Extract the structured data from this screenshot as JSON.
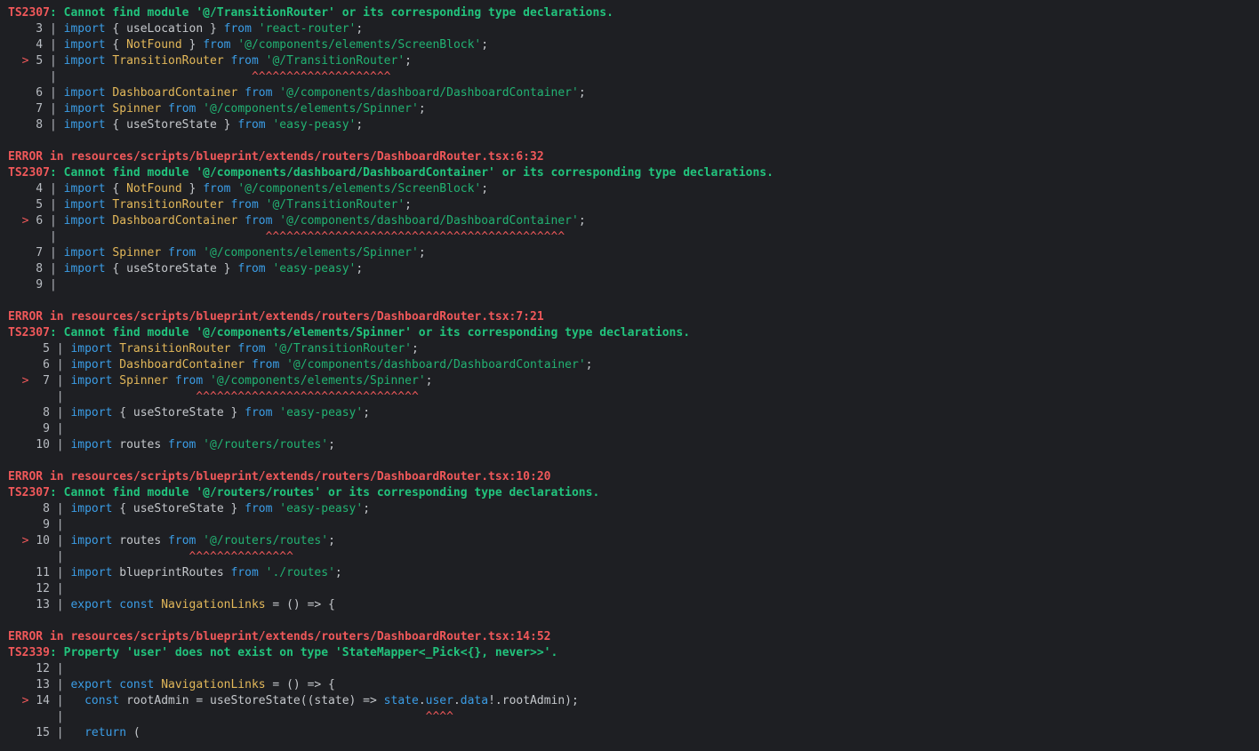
{
  "colors": {
    "background": "#1e1f23",
    "error": "#f0585a",
    "message": "#22c47d",
    "keyword": "#3b9de6",
    "identifier": "#e3b85a",
    "string": "#22b373",
    "plain": "#c5c8cc"
  },
  "lines": [
    [
      [
        "red",
        "TS2307"
      ],
      [
        "grn",
        ": Cannot find module '@/TransitionRouter' or its corresponding type declarations."
      ]
    ],
    [
      [
        "ln",
        "    3 | "
      ],
      [
        "kw",
        "import"
      ],
      [
        "pl",
        " { useLocation } "
      ],
      [
        "kw",
        "from"
      ],
      [
        "str",
        " 'react-router'"
      ],
      [
        "pl",
        ";"
      ]
    ],
    [
      [
        "ln",
        "    4 | "
      ],
      [
        "kw",
        "import"
      ],
      [
        "pl",
        " { "
      ],
      [
        "id",
        "NotFound"
      ],
      [
        "pl",
        " } "
      ],
      [
        "kw",
        "from"
      ],
      [
        "str",
        " '@/components/elements/ScreenBlock'"
      ],
      [
        "pl",
        ";"
      ]
    ],
    [
      [
        "code-red",
        "  > "
      ],
      [
        "ln",
        "5 | "
      ],
      [
        "kw",
        "import"
      ],
      [
        "id",
        " TransitionRouter "
      ],
      [
        "kw",
        "from"
      ],
      [
        "str",
        " '@/TransitionRouter'"
      ],
      [
        "pl",
        ";"
      ]
    ],
    [
      [
        "ln",
        "      | "
      ],
      [
        "code-red",
        "                           ^^^^^^^^^^^^^^^^^^^^"
      ]
    ],
    [
      [
        "ln",
        "    6 | "
      ],
      [
        "kw",
        "import"
      ],
      [
        "id",
        " DashboardContainer "
      ],
      [
        "kw",
        "from"
      ],
      [
        "str",
        " '@/components/dashboard/DashboardContainer'"
      ],
      [
        "pl",
        ";"
      ]
    ],
    [
      [
        "ln",
        "    7 | "
      ],
      [
        "kw",
        "import"
      ],
      [
        "id",
        " Spinner "
      ],
      [
        "kw",
        "from"
      ],
      [
        "str",
        " '@/components/elements/Spinner'"
      ],
      [
        "pl",
        ";"
      ]
    ],
    [
      [
        "ln",
        "    8 | "
      ],
      [
        "kw",
        "import"
      ],
      [
        "pl",
        " { useStoreState } "
      ],
      [
        "kw",
        "from"
      ],
      [
        "str",
        " 'easy-peasy'"
      ],
      [
        "pl",
        ";"
      ]
    ],
    [],
    [
      [
        "red",
        "ERROR in resources/scripts/blueprint/extends/routers/DashboardRouter.tsx:6:32"
      ]
    ],
    [
      [
        "red",
        "TS2307"
      ],
      [
        "grn",
        ": Cannot find module '@/components/dashboard/DashboardContainer' or its corresponding type declarations."
      ]
    ],
    [
      [
        "ln",
        "    4 | "
      ],
      [
        "kw",
        "import"
      ],
      [
        "pl",
        " { "
      ],
      [
        "id",
        "NotFound"
      ],
      [
        "pl",
        " } "
      ],
      [
        "kw",
        "from"
      ],
      [
        "str",
        " '@/components/elements/ScreenBlock'"
      ],
      [
        "pl",
        ";"
      ]
    ],
    [
      [
        "ln",
        "    5 | "
      ],
      [
        "kw",
        "import"
      ],
      [
        "id",
        " TransitionRouter "
      ],
      [
        "kw",
        "from"
      ],
      [
        "str",
        " '@/TransitionRouter'"
      ],
      [
        "pl",
        ";"
      ]
    ],
    [
      [
        "code-red",
        "  > "
      ],
      [
        "ln",
        "6 | "
      ],
      [
        "kw",
        "import"
      ],
      [
        "id",
        " DashboardContainer "
      ],
      [
        "kw",
        "from"
      ],
      [
        "str",
        " '@/components/dashboard/DashboardContainer'"
      ],
      [
        "pl",
        ";"
      ]
    ],
    [
      [
        "ln",
        "      | "
      ],
      [
        "code-red",
        "                             ^^^^^^^^^^^^^^^^^^^^^^^^^^^^^^^^^^^^^^^^^^^"
      ]
    ],
    [
      [
        "ln",
        "    7 | "
      ],
      [
        "kw",
        "import"
      ],
      [
        "id",
        " Spinner "
      ],
      [
        "kw",
        "from"
      ],
      [
        "str",
        " '@/components/elements/Spinner'"
      ],
      [
        "pl",
        ";"
      ]
    ],
    [
      [
        "ln",
        "    8 | "
      ],
      [
        "kw",
        "import"
      ],
      [
        "pl",
        " { useStoreState } "
      ],
      [
        "kw",
        "from"
      ],
      [
        "str",
        " 'easy-peasy'"
      ],
      [
        "pl",
        ";"
      ]
    ],
    [
      [
        "ln",
        "    9 |"
      ]
    ],
    [],
    [
      [
        "red",
        "ERROR in resources/scripts/blueprint/extends/routers/DashboardRouter.tsx:7:21"
      ]
    ],
    [
      [
        "red",
        "TS2307"
      ],
      [
        "grn",
        ": Cannot find module '@/components/elements/Spinner' or its corresponding type declarations."
      ]
    ],
    [
      [
        "ln",
        "     5 | "
      ],
      [
        "kw",
        "import"
      ],
      [
        "id",
        " TransitionRouter "
      ],
      [
        "kw",
        "from"
      ],
      [
        "str",
        " '@/TransitionRouter'"
      ],
      [
        "pl",
        ";"
      ]
    ],
    [
      [
        "ln",
        "     6 | "
      ],
      [
        "kw",
        "import"
      ],
      [
        "id",
        " DashboardContainer "
      ],
      [
        "kw",
        "from"
      ],
      [
        "str",
        " '@/components/dashboard/DashboardContainer'"
      ],
      [
        "pl",
        ";"
      ]
    ],
    [
      [
        "code-red",
        "  >  "
      ],
      [
        "ln",
        "7 | "
      ],
      [
        "kw",
        "import"
      ],
      [
        "id",
        " Spinner "
      ],
      [
        "kw",
        "from"
      ],
      [
        "str",
        " '@/components/elements/Spinner'"
      ],
      [
        "pl",
        ";"
      ]
    ],
    [
      [
        "ln",
        "       | "
      ],
      [
        "code-red",
        "                  ^^^^^^^^^^^^^^^^^^^^^^^^^^^^^^^^"
      ]
    ],
    [
      [
        "ln",
        "     8 | "
      ],
      [
        "kw",
        "import"
      ],
      [
        "pl",
        " { useStoreState } "
      ],
      [
        "kw",
        "from"
      ],
      [
        "str",
        " 'easy-peasy'"
      ],
      [
        "pl",
        ";"
      ]
    ],
    [
      [
        "ln",
        "     9 |"
      ]
    ],
    [
      [
        "ln",
        "    10 | "
      ],
      [
        "kw",
        "import"
      ],
      [
        "pl",
        " routes "
      ],
      [
        "kw",
        "from"
      ],
      [
        "str",
        " '@/routers/routes'"
      ],
      [
        "pl",
        ";"
      ]
    ],
    [],
    [
      [
        "red",
        "ERROR in resources/scripts/blueprint/extends/routers/DashboardRouter.tsx:10:20"
      ]
    ],
    [
      [
        "red",
        "TS2307"
      ],
      [
        "grn",
        ": Cannot find module '@/routers/routes' or its corresponding type declarations."
      ]
    ],
    [
      [
        "ln",
        "     8 | "
      ],
      [
        "kw",
        "import"
      ],
      [
        "pl",
        " { useStoreState } "
      ],
      [
        "kw",
        "from"
      ],
      [
        "str",
        " 'easy-peasy'"
      ],
      [
        "pl",
        ";"
      ]
    ],
    [
      [
        "ln",
        "     9 |"
      ]
    ],
    [
      [
        "code-red",
        "  > "
      ],
      [
        "ln",
        "10 | "
      ],
      [
        "kw",
        "import"
      ],
      [
        "pl",
        " routes "
      ],
      [
        "kw",
        "from"
      ],
      [
        "str",
        " '@/routers/routes'"
      ],
      [
        "pl",
        ";"
      ]
    ],
    [
      [
        "ln",
        "       | "
      ],
      [
        "code-red",
        "                 ^^^^^^^^^^^^^^^"
      ]
    ],
    [
      [
        "ln",
        "    11 | "
      ],
      [
        "kw",
        "import"
      ],
      [
        "pl",
        " blueprintRoutes "
      ],
      [
        "kw",
        "from"
      ],
      [
        "str",
        " './routes'"
      ],
      [
        "pl",
        ";"
      ]
    ],
    [
      [
        "ln",
        "    12 |"
      ]
    ],
    [
      [
        "ln",
        "    13 | "
      ],
      [
        "kw",
        "export const"
      ],
      [
        "id",
        " NavigationLinks"
      ],
      [
        "pl",
        " = () => {"
      ]
    ],
    [],
    [
      [
        "red",
        "ERROR in resources/scripts/blueprint/extends/routers/DashboardRouter.tsx:14:52"
      ]
    ],
    [
      [
        "red",
        "TS2339"
      ],
      [
        "grn",
        ": Property 'user' does not exist on type 'StateMapper<_Pick<{}, never>>'."
      ]
    ],
    [
      [
        "ln",
        "    12 |"
      ]
    ],
    [
      [
        "ln",
        "    13 | "
      ],
      [
        "kw",
        "export const"
      ],
      [
        "id",
        " NavigationLinks"
      ],
      [
        "pl",
        " = () => {"
      ]
    ],
    [
      [
        "code-red",
        "  > "
      ],
      [
        "ln",
        "14 |   "
      ],
      [
        "kw",
        "const"
      ],
      [
        "pl",
        " rootAdmin = useStoreState((state) => "
      ],
      [
        "kw",
        "state"
      ],
      [
        "pl",
        "."
      ],
      [
        "kw",
        "user"
      ],
      [
        "pl",
        "."
      ],
      [
        "kw",
        "data"
      ],
      [
        "pl",
        "!.rootAdmin);"
      ]
    ],
    [
      [
        "ln",
        "       | "
      ],
      [
        "code-red",
        "                                                   ^^^^"
      ]
    ],
    [
      [
        "ln",
        "    15 |   "
      ],
      [
        "kw",
        "return"
      ],
      [
        "pl",
        " ("
      ]
    ]
  ]
}
